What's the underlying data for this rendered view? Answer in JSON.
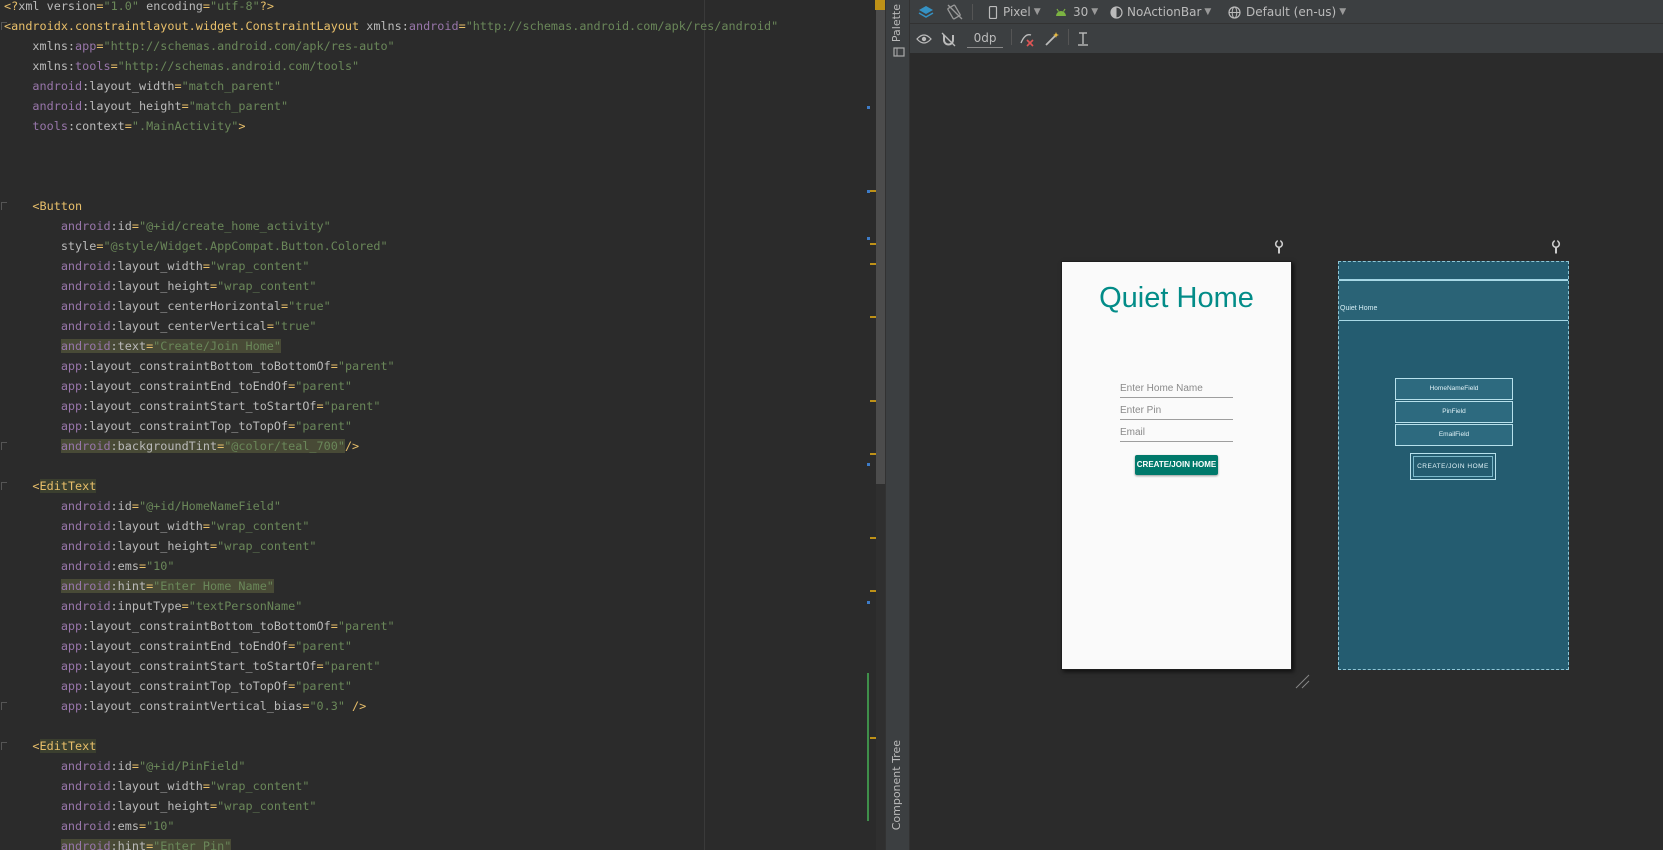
{
  "editor": {
    "lines": [
      [
        [
          "t-punc",
          "<?"
        ],
        [
          "t-attr",
          "xml version"
        ],
        [
          "t-punc",
          "="
        ],
        [
          "t-val",
          "\"1.0\""
        ],
        [
          "t-attr",
          " encoding"
        ],
        [
          "t-punc",
          "="
        ],
        [
          "t-val",
          "\"utf-8\""
        ],
        [
          "t-punc",
          "?>"
        ]
      ],
      [
        [
          "t-punc",
          "<"
        ],
        [
          "t-tag",
          "androidx.constraintlayout.widget.ConstraintLayout"
        ],
        [
          "t-plain",
          " "
        ],
        [
          "t-attr",
          "xmlns:"
        ],
        [
          "t-ns",
          "android"
        ],
        [
          "t-punc",
          "="
        ],
        [
          "t-val",
          "\"http://schemas.android.com/apk/res/android\""
        ]
      ],
      [
        [
          "t-plain",
          "    "
        ],
        [
          "t-attr",
          "xmlns:"
        ],
        [
          "t-ns",
          "app"
        ],
        [
          "t-punc",
          "="
        ],
        [
          "t-val",
          "\"http://schemas.android.com/apk/res-auto\""
        ]
      ],
      [
        [
          "t-plain",
          "    "
        ],
        [
          "t-attr",
          "xmlns:"
        ],
        [
          "t-ns",
          "tools"
        ],
        [
          "t-punc",
          "="
        ],
        [
          "t-val",
          "\"http://schemas.android.com/tools\""
        ]
      ],
      [
        [
          "t-plain",
          "    "
        ],
        [
          "t-ns",
          "android"
        ],
        [
          "t-attr",
          ":layout_width"
        ],
        [
          "t-punc",
          "="
        ],
        [
          "t-val",
          "\"match_parent\""
        ]
      ],
      [
        [
          "t-plain",
          "    "
        ],
        [
          "t-ns",
          "android"
        ],
        [
          "t-attr",
          ":layout_height"
        ],
        [
          "t-punc",
          "="
        ],
        [
          "t-val",
          "\"match_parent\""
        ]
      ],
      [
        [
          "t-plain",
          "    "
        ],
        [
          "t-ns",
          "tools"
        ],
        [
          "t-attr",
          ":context"
        ],
        [
          "t-punc",
          "="
        ],
        [
          "t-val",
          "\".MainActivity\""
        ],
        [
          "t-punc",
          ">"
        ]
      ],
      [],
      [],
      [],
      [
        [
          "t-plain",
          "    "
        ],
        [
          "t-punc",
          "<"
        ],
        [
          "t-tag",
          "Button"
        ]
      ],
      [
        [
          "t-plain",
          "        "
        ],
        [
          "t-ns",
          "android"
        ],
        [
          "t-attr",
          ":id"
        ],
        [
          "t-punc",
          "="
        ],
        [
          "t-val",
          "\"@+id/create_home_activity\""
        ]
      ],
      [
        [
          "t-plain",
          "        "
        ],
        [
          "t-attr",
          "style"
        ],
        [
          "t-punc",
          "="
        ],
        [
          "t-val",
          "\"@style/Widget.AppCompat.Button.Colored\""
        ]
      ],
      [
        [
          "t-plain",
          "        "
        ],
        [
          "t-ns",
          "android"
        ],
        [
          "t-attr",
          ":layout_width"
        ],
        [
          "t-punc",
          "="
        ],
        [
          "t-val",
          "\"wrap_content\""
        ]
      ],
      [
        [
          "t-plain",
          "        "
        ],
        [
          "t-ns",
          "android"
        ],
        [
          "t-attr",
          ":layout_height"
        ],
        [
          "t-punc",
          "="
        ],
        [
          "t-val",
          "\"wrap_content\""
        ]
      ],
      [
        [
          "t-plain",
          "        "
        ],
        [
          "t-ns",
          "android"
        ],
        [
          "t-attr",
          ":layout_centerHorizontal"
        ],
        [
          "t-punc",
          "="
        ],
        [
          "t-val",
          "\"true\""
        ]
      ],
      [
        [
          "t-plain",
          "        "
        ],
        [
          "t-ns",
          "android"
        ],
        [
          "t-attr",
          ":layout_centerVertical"
        ],
        [
          "t-punc",
          "="
        ],
        [
          "t-val",
          "\"true\""
        ]
      ],
      [
        [
          "t-plain",
          "        "
        ],
        [
          "t-ns hl",
          "android"
        ],
        [
          "t-attr hl",
          ":text"
        ],
        [
          "t-punc hl",
          "="
        ],
        [
          "t-val hl",
          "\"Create/Join Home\""
        ]
      ],
      [
        [
          "t-plain",
          "        "
        ],
        [
          "t-ns",
          "app"
        ],
        [
          "t-attr",
          ":layout_constraintBottom_toBottomOf"
        ],
        [
          "t-punc",
          "="
        ],
        [
          "t-val",
          "\"parent\""
        ]
      ],
      [
        [
          "t-plain",
          "        "
        ],
        [
          "t-ns",
          "app"
        ],
        [
          "t-attr",
          ":layout_constraintEnd_toEndOf"
        ],
        [
          "t-punc",
          "="
        ],
        [
          "t-val",
          "\"parent\""
        ]
      ],
      [
        [
          "t-plain",
          "        "
        ],
        [
          "t-ns",
          "app"
        ],
        [
          "t-attr",
          ":layout_constraintStart_toStartOf"
        ],
        [
          "t-punc",
          "="
        ],
        [
          "t-val",
          "\"parent\""
        ]
      ],
      [
        [
          "t-plain",
          "        "
        ],
        [
          "t-ns",
          "app"
        ],
        [
          "t-attr",
          ":layout_constraintTop_toTopOf"
        ],
        [
          "t-punc",
          "="
        ],
        [
          "t-val",
          "\"parent\""
        ]
      ],
      [
        [
          "t-plain",
          "        "
        ],
        [
          "t-ns hl",
          "android"
        ],
        [
          "t-attr hl",
          ":backgroundTint"
        ],
        [
          "t-punc hl",
          "="
        ],
        [
          "t-val hl",
          "\"@color/teal_700\""
        ],
        [
          "t-punc",
          "/>"
        ]
      ],
      [],
      [
        [
          "t-plain",
          "    "
        ],
        [
          "t-punc",
          "<"
        ],
        [
          "t-tag tag-hl",
          "EditText"
        ]
      ],
      [
        [
          "t-plain",
          "        "
        ],
        [
          "t-ns",
          "android"
        ],
        [
          "t-attr",
          ":id"
        ],
        [
          "t-punc",
          "="
        ],
        [
          "t-val",
          "\"@+id/HomeNameField\""
        ]
      ],
      [
        [
          "t-plain",
          "        "
        ],
        [
          "t-ns",
          "android"
        ],
        [
          "t-attr",
          ":layout_width"
        ],
        [
          "t-punc",
          "="
        ],
        [
          "t-val",
          "\"wrap_content\""
        ]
      ],
      [
        [
          "t-plain",
          "        "
        ],
        [
          "t-ns",
          "android"
        ],
        [
          "t-attr",
          ":layout_height"
        ],
        [
          "t-punc",
          "="
        ],
        [
          "t-val",
          "\"wrap_content\""
        ]
      ],
      [
        [
          "t-plain",
          "        "
        ],
        [
          "t-ns",
          "android"
        ],
        [
          "t-attr",
          ":ems"
        ],
        [
          "t-punc",
          "="
        ],
        [
          "t-val",
          "\"10\""
        ]
      ],
      [
        [
          "t-plain",
          "        "
        ],
        [
          "t-ns hl",
          "android"
        ],
        [
          "t-attr hl",
          ":hint"
        ],
        [
          "t-punc hl",
          "="
        ],
        [
          "t-val hl",
          "\"Enter Home Name\""
        ]
      ],
      [
        [
          "t-plain",
          "        "
        ],
        [
          "t-ns",
          "android"
        ],
        [
          "t-attr",
          ":inputType"
        ],
        [
          "t-punc",
          "="
        ],
        [
          "t-val",
          "\"textPersonName\""
        ]
      ],
      [
        [
          "t-plain",
          "        "
        ],
        [
          "t-ns",
          "app"
        ],
        [
          "t-attr",
          ":layout_constraintBottom_toBottomOf"
        ],
        [
          "t-punc",
          "="
        ],
        [
          "t-val",
          "\"parent\""
        ]
      ],
      [
        [
          "t-plain",
          "        "
        ],
        [
          "t-ns",
          "app"
        ],
        [
          "t-attr",
          ":layout_constraintEnd_toEndOf"
        ],
        [
          "t-punc",
          "="
        ],
        [
          "t-val",
          "\"parent\""
        ]
      ],
      [
        [
          "t-plain",
          "        "
        ],
        [
          "t-ns",
          "app"
        ],
        [
          "t-attr",
          ":layout_constraintStart_toStartOf"
        ],
        [
          "t-punc",
          "="
        ],
        [
          "t-val",
          "\"parent\""
        ]
      ],
      [
        [
          "t-plain",
          "        "
        ],
        [
          "t-ns",
          "app"
        ],
        [
          "t-attr",
          ":layout_constraintTop_toTopOf"
        ],
        [
          "t-punc",
          "="
        ],
        [
          "t-val",
          "\"parent\""
        ]
      ],
      [
        [
          "t-plain",
          "        "
        ],
        [
          "t-ns",
          "app"
        ],
        [
          "t-attr",
          ":layout_constraintVertical_bias"
        ],
        [
          "t-punc",
          "="
        ],
        [
          "t-val",
          "\"0.3\""
        ],
        [
          "t-punc",
          " />"
        ]
      ],
      [],
      [
        [
          "t-plain",
          "    "
        ],
        [
          "t-punc",
          "<"
        ],
        [
          "t-tag tag-hl",
          "EditText"
        ]
      ],
      [
        [
          "t-plain",
          "        "
        ],
        [
          "t-ns",
          "android"
        ],
        [
          "t-attr",
          ":id"
        ],
        [
          "t-punc",
          "="
        ],
        [
          "t-val",
          "\"@+id/PinField\""
        ]
      ],
      [
        [
          "t-plain",
          "        "
        ],
        [
          "t-ns",
          "android"
        ],
        [
          "t-attr",
          ":layout_width"
        ],
        [
          "t-punc",
          "="
        ],
        [
          "t-val",
          "\"wrap_content\""
        ]
      ],
      [
        [
          "t-plain",
          "        "
        ],
        [
          "t-ns",
          "android"
        ],
        [
          "t-attr",
          ":layout_height"
        ],
        [
          "t-punc",
          "="
        ],
        [
          "t-val",
          "\"wrap_content\""
        ]
      ],
      [
        [
          "t-plain",
          "        "
        ],
        [
          "t-ns",
          "android"
        ],
        [
          "t-attr",
          ":ems"
        ],
        [
          "t-punc",
          "="
        ],
        [
          "t-val",
          "\"10\""
        ]
      ],
      [
        [
          "t-plain",
          "        "
        ],
        [
          "t-ns hl",
          "android"
        ],
        [
          "t-attr hl",
          ":hint"
        ],
        [
          "t-punc hl",
          "="
        ],
        [
          "t-val hl",
          "\"Enter Pin\""
        ]
      ]
    ]
  },
  "sidebar": {
    "palette_label": "Palette",
    "component_tree_label": "Component Tree"
  },
  "toolbar": {
    "device": "Pixel",
    "api_level": "30",
    "theme": "NoActionBar",
    "locale": "Default (en-us)",
    "margin_value": "0dp"
  },
  "design": {
    "title": "Quiet Home",
    "home_name_hint": "Enter Home Name",
    "pin_hint": "Enter Pin",
    "email_hint": "Email",
    "button_label": "CREATE/JOIN HOME"
  },
  "blueprint": {
    "title_label": "Quiet Home",
    "home_name_field": "HomeNameField",
    "pin_field": "PinField",
    "email_field": "EmailField",
    "button_label": "CREATE/JOIN HOME"
  },
  "colors": {
    "accent_teal": "#028c88",
    "button_teal": "#00796b",
    "blueprint_bg": "#245c70",
    "warning_marker": "#be9117"
  }
}
